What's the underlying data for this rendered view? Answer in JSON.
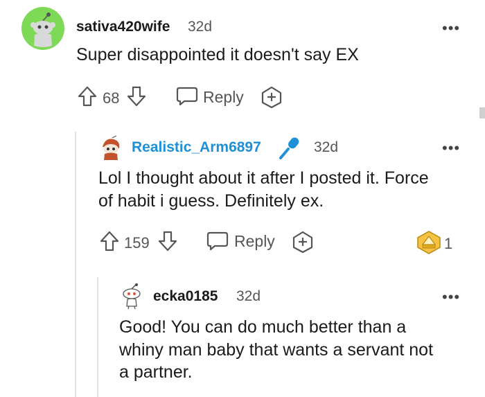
{
  "comments": [
    {
      "username": "sativa420wife",
      "age": "32d",
      "body": "Super disappointed it doesn't say EX",
      "votes": "68",
      "reply_label": "Reply"
    },
    {
      "username": "Realistic_Arm6897",
      "age": "32d",
      "body_lines": [
        "Lol I thought about it after I posted it. Force",
        "of habit i guess. Definitely ex."
      ],
      "votes": "159",
      "reply_label": "Reply",
      "award_count": "1"
    },
    {
      "username": "ecka0185",
      "age": "32d",
      "body_lines": [
        "Good! You can do much better than a",
        "whiny man baby that wants a servant not",
        "a partner."
      ]
    }
  ],
  "more_label": "•••",
  "colors": {
    "accent_blue": "#1e90d8",
    "avatar_green": "#7ed957",
    "text": "#1a1a1b",
    "muted": "#555555"
  }
}
